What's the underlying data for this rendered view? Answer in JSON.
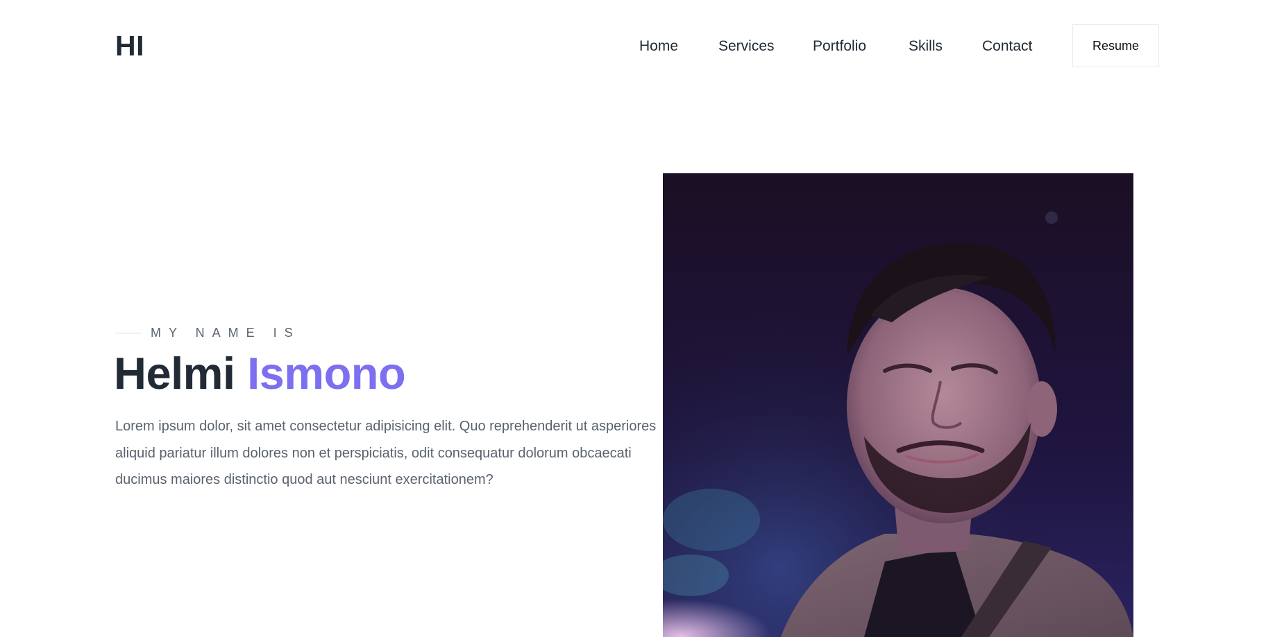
{
  "header": {
    "logo": "HI",
    "nav": [
      {
        "label": "Home"
      },
      {
        "label": "Services"
      },
      {
        "label": "Portfolio"
      },
      {
        "label": "Skills"
      },
      {
        "label": "Contact"
      }
    ],
    "resume_label": "Resume"
  },
  "hero": {
    "eyebrow": "MY NAME IS",
    "first_name": "Helmi",
    "last_name": "Ismono",
    "bio": "Lorem ipsum dolor, sit amet consectetur adipisicing elit. Quo reprehenderit ut asperiores aliquid pariatur illum dolores non et perspiciatis, odit consequatur dolorum obcaecati ducimus maiores distinctio quod aut nesciunt exercitationem?"
  },
  "colors": {
    "accent": "#7c6ff0",
    "heading": "#212b36",
    "body_text": "#5a636d"
  }
}
